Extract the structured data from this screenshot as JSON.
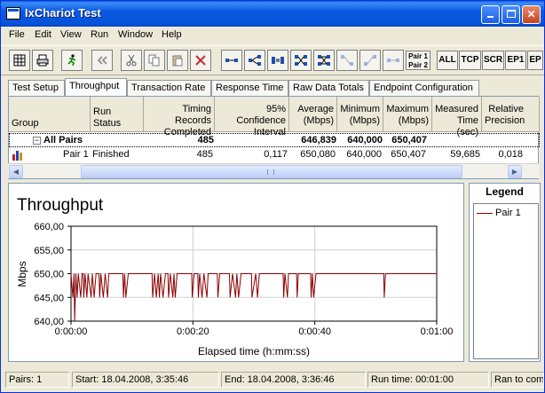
{
  "window": {
    "title": "IxChariot Test"
  },
  "menu": [
    "File",
    "Edit",
    "View",
    "Run",
    "Window",
    "Help"
  ],
  "toolbar": {
    "pair_label_1": "Pair 1",
    "pair_label_2": "Pair 2",
    "text_buttons": [
      "ALL",
      "TCP",
      "SCR",
      "EP1",
      "EP"
    ]
  },
  "tabs": [
    "Test Setup",
    "Throughput",
    "Transaction Rate",
    "Response Time",
    "Raw Data Totals",
    "Endpoint Configuration"
  ],
  "active_tab": "Throughput",
  "grid": {
    "columns": [
      {
        "label": "Group"
      },
      {
        "label": "Run Status"
      },
      {
        "label": "Timing Records Completed"
      },
      {
        "label": "95% Confidence Interval"
      },
      {
        "label": "Average (Mbps)"
      },
      {
        "label": "Minimum (Mbps)"
      },
      {
        "label": "Maximum (Mbps)"
      },
      {
        "label": "Measured Time (sec)"
      },
      {
        "label": "Relative Precision"
      }
    ],
    "rows": [
      {
        "group": "All Pairs",
        "status": "",
        "records": "485",
        "ci": "",
        "avg": "646,839",
        "min": "640,000",
        "max": "650,407",
        "time": "",
        "precision": ""
      },
      {
        "group": "Pair 1",
        "status": "Finished",
        "records": "485",
        "ci": "0,117",
        "avg": "650,080",
        "min": "640,000",
        "max": "650,407",
        "time": "59,685",
        "precision": "0,018"
      }
    ]
  },
  "chart_data": {
    "type": "line",
    "title": "Throughput",
    "xlabel": "Elapsed time (h:mm:ss)",
    "ylabel": "Mbps",
    "ylim": [
      640,
      660
    ],
    "yticks": [
      "640,00",
      "645,00",
      "650,00",
      "655,00",
      "660,00"
    ],
    "xlim": [
      0,
      60
    ],
    "xticks": [
      "0:00:00",
      "0:00:20",
      "0:00:40",
      "0:01:00"
    ],
    "grid": true,
    "series": [
      {
        "name": "Pair 1",
        "color": "#8b0000",
        "points": [
          [
            0.0,
            650
          ],
          [
            0.3,
            645
          ],
          [
            0.5,
            650
          ],
          [
            0.6,
            640
          ],
          [
            0.8,
            650
          ],
          [
            1.0,
            645
          ],
          [
            1.2,
            650
          ],
          [
            1.6,
            645
          ],
          [
            1.8,
            650
          ],
          [
            2.0,
            650
          ],
          [
            2.1,
            645
          ],
          [
            2.3,
            650
          ],
          [
            2.6,
            645
          ],
          [
            2.8,
            650
          ],
          [
            3.3,
            645
          ],
          [
            3.5,
            650
          ],
          [
            3.8,
            645
          ],
          [
            4.1,
            650
          ],
          [
            4.6,
            650
          ],
          [
            4.7,
            645
          ],
          [
            4.9,
            650
          ],
          [
            5.3,
            645
          ],
          [
            5.6,
            650
          ],
          [
            6.0,
            645
          ],
          [
            6.2,
            650
          ],
          [
            8.5,
            650
          ],
          [
            8.6,
            645
          ],
          [
            8.8,
            650
          ],
          [
            9.0,
            645
          ],
          [
            9.4,
            650
          ],
          [
            13.3,
            650
          ],
          [
            13.4,
            645
          ],
          [
            13.7,
            650
          ],
          [
            14.0,
            645
          ],
          [
            14.3,
            650
          ],
          [
            14.5,
            645
          ],
          [
            14.7,
            650
          ],
          [
            15.1,
            645
          ],
          [
            15.5,
            650
          ],
          [
            15.9,
            650
          ],
          [
            16.0,
            645
          ],
          [
            16.3,
            650
          ],
          [
            16.7,
            645
          ],
          [
            16.9,
            650
          ],
          [
            17.1,
            645
          ],
          [
            17.4,
            650
          ],
          [
            19.8,
            650
          ],
          [
            19.9,
            645
          ],
          [
            20.2,
            650
          ],
          [
            20.8,
            650
          ],
          [
            20.9,
            645
          ],
          [
            21.1,
            650
          ],
          [
            21.5,
            645
          ],
          [
            21.8,
            650
          ],
          [
            22.3,
            645
          ],
          [
            22.5,
            650
          ],
          [
            24.0,
            650
          ],
          [
            24.1,
            645
          ],
          [
            24.4,
            650
          ],
          [
            26.0,
            650
          ],
          [
            26.1,
            645
          ],
          [
            26.5,
            650
          ],
          [
            27.0,
            645
          ],
          [
            27.2,
            650
          ],
          [
            27.5,
            645
          ],
          [
            27.9,
            650
          ],
          [
            29.6,
            650
          ],
          [
            29.7,
            645
          ],
          [
            30.3,
            650
          ],
          [
            30.6,
            645
          ],
          [
            30.9,
            650
          ],
          [
            34.8,
            650
          ],
          [
            34.9,
            645
          ],
          [
            35.1,
            650
          ],
          [
            35.5,
            645
          ],
          [
            35.7,
            650
          ],
          [
            37.0,
            650
          ],
          [
            37.1,
            645
          ],
          [
            37.3,
            650
          ],
          [
            39.3,
            650
          ],
          [
            39.4,
            645
          ],
          [
            39.6,
            650
          ],
          [
            39.8,
            645
          ],
          [
            40.2,
            650
          ],
          [
            51.3,
            650
          ],
          [
            51.4,
            645
          ],
          [
            51.6,
            650
          ],
          [
            60.0,
            650
          ]
        ]
      }
    ]
  },
  "legend": {
    "title": "Legend",
    "items": [
      "Pair 1"
    ]
  },
  "status": {
    "pairs": "Pairs: 1",
    "start": "Start: 18.04.2008, 3:35:46",
    "end": "End: 18.04.2008, 3:36:46",
    "runtime": "Run time: 00:01:00",
    "msg": "Ran to com"
  }
}
